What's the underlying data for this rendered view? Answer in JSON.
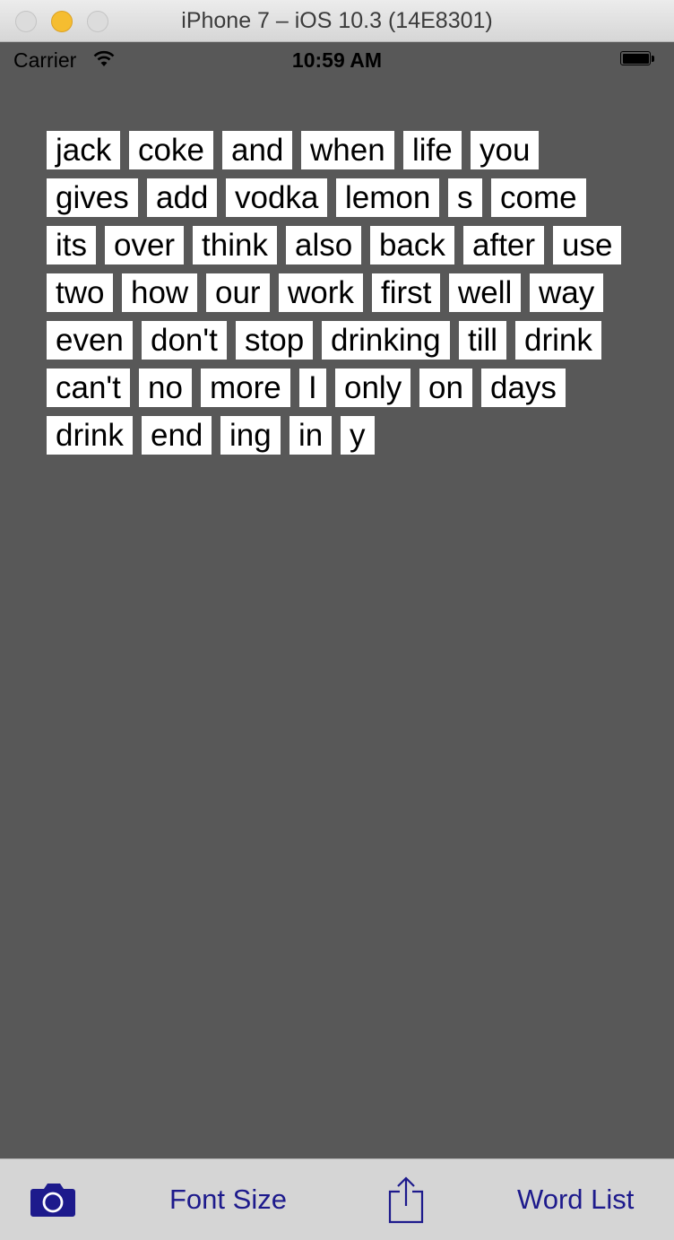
{
  "window": {
    "title": "iPhone 7 – iOS 10.3 (14E8301)"
  },
  "status_bar": {
    "carrier": "Carrier",
    "time": "10:59 AM"
  },
  "word_tiles": [
    "jack",
    "coke",
    "and",
    "when",
    "life",
    "you",
    "gives",
    "add",
    "vodka",
    "lemon",
    "s",
    "come",
    "its",
    "over",
    "think",
    "also",
    "back",
    "after",
    "use",
    "two",
    "how",
    "our",
    "work",
    "first",
    "well",
    "way",
    "even",
    "don't",
    "stop",
    "drinking",
    "till",
    "drink",
    "can't",
    "no",
    "more",
    "I",
    "only",
    "on",
    "days",
    "drink",
    "end",
    "ing",
    "in",
    "y"
  ],
  "toolbar": {
    "camera_icon": "camera-icon",
    "font_size_label": "Font Size",
    "share_icon": "share-icon",
    "word_list_label": "Word List"
  },
  "colors": {
    "background": "#585858",
    "tile": "#ffffff",
    "tint": "#1d1a8c",
    "toolbar": "#d5d5d5"
  }
}
